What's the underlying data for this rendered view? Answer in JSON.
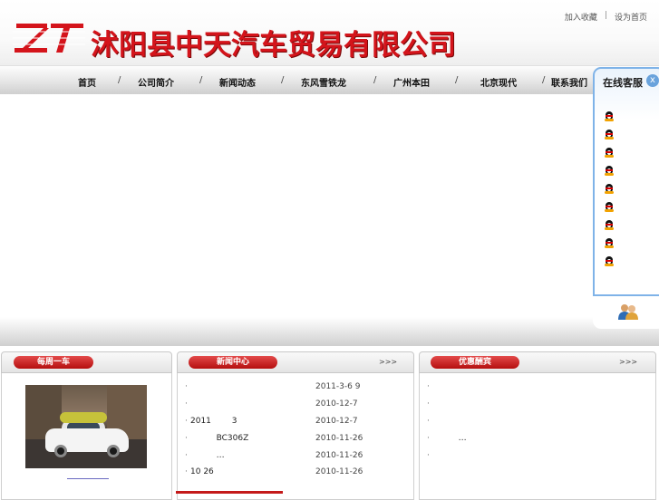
{
  "header": {
    "logo_text": "ZT",
    "company_name": "沭阳县中天汽车贸易有限公司",
    "links": [
      "加入收藏",
      "设为首页"
    ],
    "link_sep": "|"
  },
  "nav": {
    "items": [
      "首页",
      "公司简介",
      "新闻动态",
      "东风雪铁龙",
      "广州本田",
      "北京现代",
      "联系我们"
    ],
    "sep": "/"
  },
  "service": {
    "title": "在线客服",
    "close": "x",
    "agent_count": 9
  },
  "columns": {
    "weekly_car": {
      "title": "每周一车"
    },
    "news": {
      "title": "新闻中心",
      "more": ">>>",
      "rows": [
        {
          "text": "",
          "date": "2011-3-6 9"
        },
        {
          "text": "",
          "date": "2010-12-7"
        },
        {
          "text": "2011        3",
          "date": "2010-12-7"
        },
        {
          "text": "          BC306Z",
          "date": "2010-11-26"
        },
        {
          "text": "          …",
          "date": "2010-11-26"
        },
        {
          "text": "10 26",
          "date": "2010-11-26"
        }
      ]
    },
    "promo": {
      "title": "优惠酬宾",
      "more": ">>>",
      "rows": [
        {
          "text": ""
        },
        {
          "text": ""
        },
        {
          "text": ""
        },
        {
          "text": "          …"
        },
        {
          "text": ""
        }
      ]
    }
  },
  "colors": {
    "brand_red": "#d4141b",
    "panel_border": "#7fb3e8"
  }
}
